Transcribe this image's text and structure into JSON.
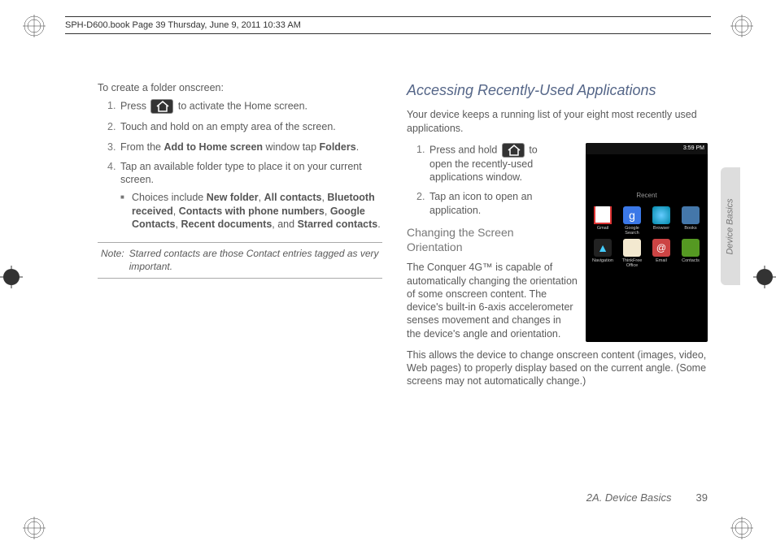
{
  "header": {
    "meta": "SPH-D600.book  Page 39  Thursday, June 9, 2011  10:33 AM"
  },
  "left": {
    "intro": "To create a folder onscreen:",
    "steps": {
      "s1a": "Press ",
      "s1b": " to activate the Home screen.",
      "s2": "Touch and hold on an empty area of the screen.",
      "s3a": "From the ",
      "s3b": "Add to Home screen",
      "s3c": " window tap ",
      "s3d": "Folders",
      "s3e": ".",
      "s4": "Tap an available folder type to place it on your current screen.",
      "bullet_a": "Choices include ",
      "nf": "New folder",
      "sep1": ", ",
      "ac": "All contacts",
      "sep2": ", ",
      "br": "Bluetooth received",
      "sep3": ", ",
      "cpn": "Contacts with phone numbers",
      "sep4": ", ",
      "gc": "Google Contacts",
      "sep5": ", ",
      "rd": "Recent documents",
      "sep6": ", and ",
      "sc": "Starred contacts",
      "sep7": "."
    },
    "note_label": "Note:",
    "note_body": "Starred contacts are those Contact entries tagged as very important."
  },
  "right": {
    "h2": "Accessing Recently-Used Applications",
    "intro": "Your device keeps a running list of your eight most recently used applications.",
    "steps": {
      "s1a": "Press and hold ",
      "s1b": " to open the recently-used applications window.",
      "s2": "Tap an icon to open an application."
    },
    "h3": "Changing the Screen Orientation",
    "p1": "The Conquer 4G™ is capable of automatically changing the orientation of some onscreen content. The device's built-in 6-axis accelerometer senses movement and changes in the device's angle and orientation.",
    "p2": "This allows the device to change onscreen content (images, video, Web pages) to properly display based on the current angle. (Some screens may not automatically change.)"
  },
  "screenshot": {
    "time": "3:59 PM",
    "recent": "Recent",
    "apps": {
      "gmail": "Gmail",
      "gsearch": "Google Search",
      "browser": "Browser",
      "books": "Books",
      "nav": "Navigation",
      "office": "ThinkFree Office",
      "email": "Email",
      "contacts": "Contacts"
    }
  },
  "sidetab": "Device Basics",
  "footer": {
    "section": "2A. Device Basics",
    "page": "39"
  }
}
